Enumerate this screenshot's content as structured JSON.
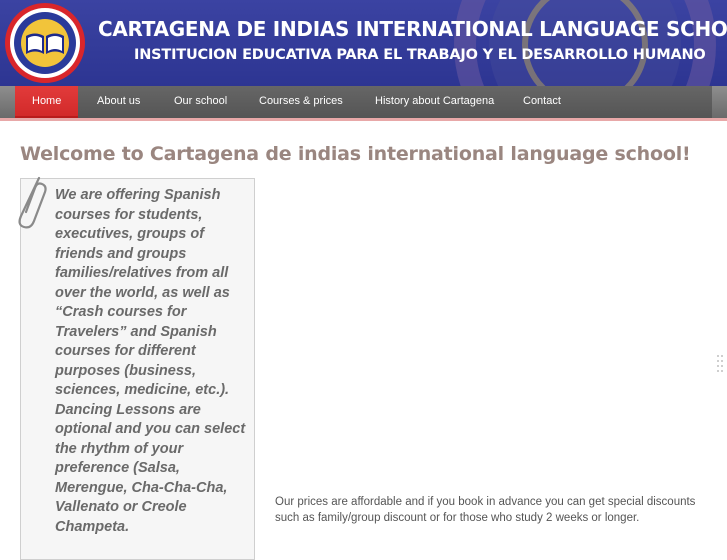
{
  "header": {
    "title": "CARTAGENA DE INDIAS INTERNATIONAL LANGUAGE SCHOOL",
    "subtitle": "INSTITUCION EDUCATIVA PARA EL TRABAJO Y EL DESARROLLO HUMANO",
    "logo_icon": "book-seal-icon",
    "colors": {
      "banner": "#2f3795",
      "logo_ring": "#d9262b",
      "logo_gold": "#f2c43a"
    }
  },
  "nav": {
    "items": [
      {
        "label": "Home",
        "active": true
      },
      {
        "label": "About us"
      },
      {
        "label": "Our school"
      },
      {
        "label": "Courses & prices"
      },
      {
        "label": "History about Cartagena"
      },
      {
        "label": "Contact"
      }
    ],
    "colors": {
      "bar": "#5f5f5f",
      "active": "#dd3333"
    }
  },
  "main": {
    "welcome": "Welcome to Cartagena de indias international language school!",
    "intro": "We are offering Spanish courses for students, executives, groups of friends and groups families/relatives from all over the world, as well as “Crash courses for Travelers” and Spanish courses for different purposes (business, sciences, medicine, etc.). Dancing Lessons are optional and you can select the rhythm of your preference (Salsa, Merengue, Cha-Cha-Cha, Vallenato or Creole Champeta.",
    "prices": "Our prices are affordable and if you book in advance you can get special discounts such as family/group discount or for those who study 2 weeks or longer.",
    "clip_icon": "paperclip-icon",
    "colors": {
      "welcome": "#9a8680",
      "intro": "#6a6a6a"
    }
  }
}
